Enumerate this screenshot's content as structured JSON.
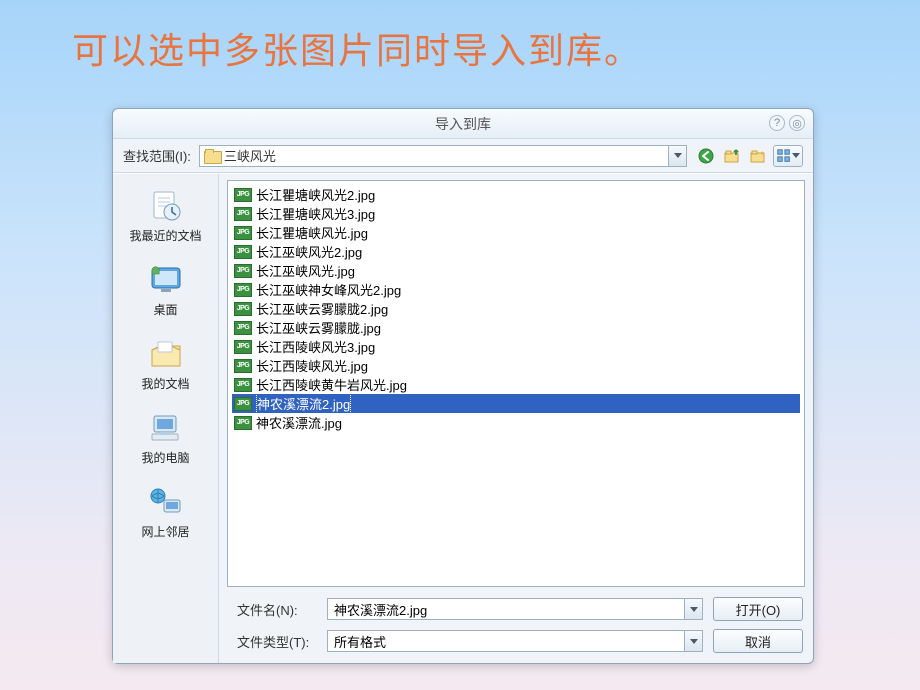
{
  "caption": "可以选中多张图片同时导入到库。",
  "dialog": {
    "title": "导入到库",
    "help_icon": "?",
    "control_icon": "◎"
  },
  "lookin": {
    "label": "查找范围(I):",
    "folder": "三峡风光"
  },
  "navicons": {
    "back": "back-icon",
    "up": "up-folder-icon",
    "new": "new-folder-icon",
    "view": "view-mode-icon"
  },
  "sidebar": [
    {
      "key": "recent",
      "label": "我最近的文档"
    },
    {
      "key": "desktop",
      "label": "桌面"
    },
    {
      "key": "mydocs",
      "label": "我的文档"
    },
    {
      "key": "mycomputer",
      "label": "我的电脑"
    },
    {
      "key": "network",
      "label": "网上邻居"
    }
  ],
  "files": [
    {
      "name": "长江瞿塘峡风光2.jpg",
      "selected": false
    },
    {
      "name": "长江瞿塘峡风光3.jpg",
      "selected": false
    },
    {
      "name": "长江瞿塘峡风光.jpg",
      "selected": false
    },
    {
      "name": "长江巫峡风光2.jpg",
      "selected": false
    },
    {
      "name": "长江巫峡风光.jpg",
      "selected": false
    },
    {
      "name": "长江巫峡神女峰风光2.jpg",
      "selected": false
    },
    {
      "name": "长江巫峡云雾朦胧2.jpg",
      "selected": false
    },
    {
      "name": "长江巫峡云雾朦胧.jpg",
      "selected": false
    },
    {
      "name": "长江西陵峡风光3.jpg",
      "selected": false
    },
    {
      "name": "长江西陵峡风光.jpg",
      "selected": false
    },
    {
      "name": "长江西陵峡黄牛岩风光.jpg",
      "selected": false
    },
    {
      "name": "神农溪漂流2.jpg",
      "selected": true
    },
    {
      "name": "神农溪漂流.jpg",
      "selected": false
    }
  ],
  "filename": {
    "label": "文件名(N):",
    "value": "神农溪漂流2.jpg"
  },
  "filetype": {
    "label": "文件类型(T):",
    "value": "所有格式"
  },
  "buttons": {
    "open": "打开(O)",
    "cancel": "取消"
  }
}
